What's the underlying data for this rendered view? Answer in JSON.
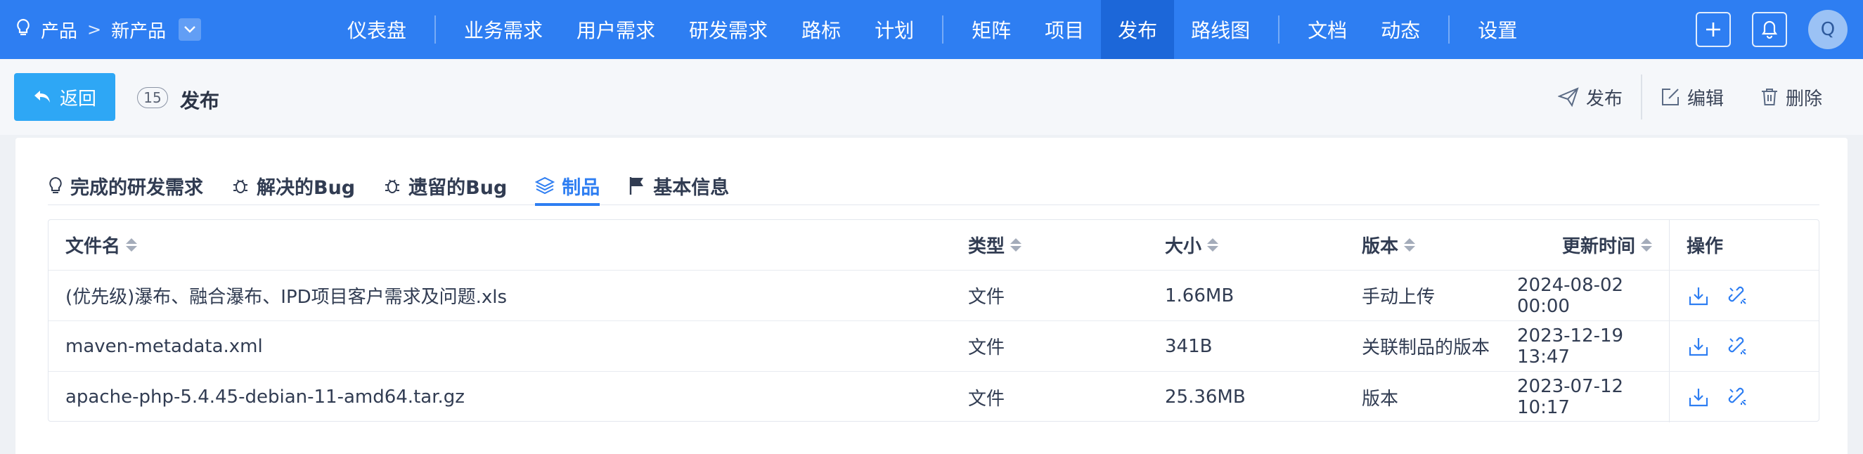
{
  "breadcrumb": {
    "root": "产品",
    "sep": ">",
    "product": "新产品"
  },
  "nav": {
    "items": [
      "仪表盘",
      "业务需求",
      "用户需求",
      "研发需求",
      "路标",
      "计划",
      "矩阵",
      "项目",
      "发布",
      "路线图",
      "文档",
      "动态",
      "设置"
    ],
    "active": "发布"
  },
  "user": {
    "avatar_initial": "Q"
  },
  "toolbar": {
    "back_label": "返回",
    "release_count": "15",
    "release_title": "发布",
    "publish_label": "发布",
    "edit_label": "编辑",
    "delete_label": "删除"
  },
  "tabs": [
    {
      "label": "完成的研发需求",
      "icon": "lightbulb-icon"
    },
    {
      "label": "解决的Bug",
      "icon": "bug-icon"
    },
    {
      "label": "遗留的Bug",
      "icon": "bug-icon"
    },
    {
      "label": "制品",
      "icon": "layers-icon",
      "active": true
    },
    {
      "label": "基本信息",
      "icon": "flag-icon"
    }
  ],
  "table": {
    "headers": {
      "name": "文件名",
      "type": "类型",
      "size": "大小",
      "version": "版本",
      "updated": "更新时间",
      "ops": "操作"
    },
    "rows": [
      {
        "name": "(优先级)瀑布、融合瀑布、IPD项目客户需求及问题.xls",
        "type": "文件",
        "size": "1.66MB",
        "version": "手动上传",
        "updated": "2024-08-02 00:00"
      },
      {
        "name": "maven-metadata.xml",
        "type": "文件",
        "size": "341B",
        "version": "关联制品的版本",
        "updated": "2023-12-19 13:47"
      },
      {
        "name": "apache-php-5.4.45-debian-11-amd64.tar.gz",
        "type": "文件",
        "size": "25.36MB",
        "version": "版本",
        "updated": "2023-07-12 10:17"
      }
    ]
  },
  "colors": {
    "primary": "#2e7ef2",
    "nav_active": "#1c67d9",
    "back_button": "#2ea7f5"
  }
}
